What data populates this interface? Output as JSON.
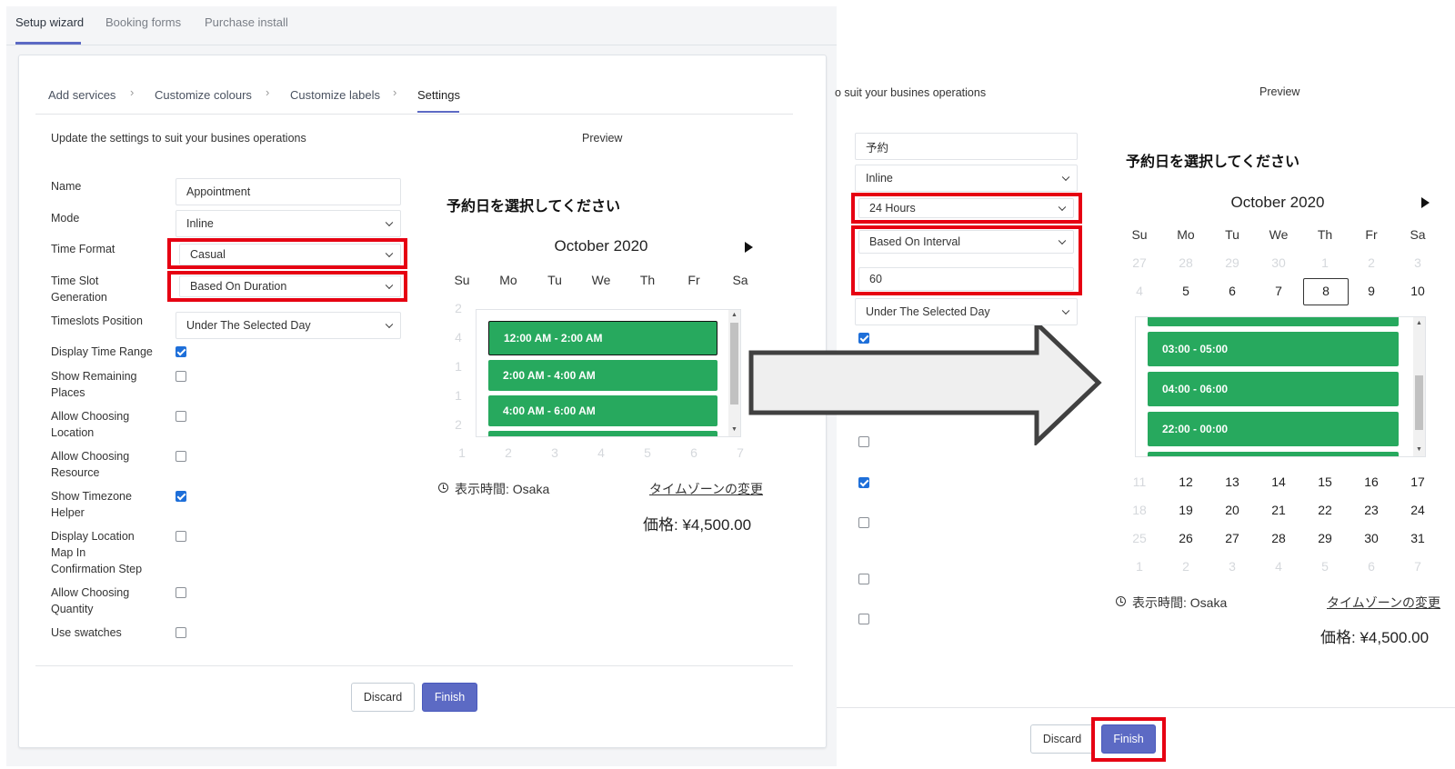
{
  "top_tabs": [
    "Setup wizard",
    "Booking forms",
    "Purchase install"
  ],
  "steps": [
    "Add services",
    "Customize colours",
    "Customize labels",
    "Settings"
  ],
  "left": {
    "subtitle": "Update the settings to suit your busines operations",
    "preview_title": "Preview",
    "fields": {
      "name_label": "Name",
      "name_value": "Appointment",
      "mode_label": "Mode",
      "mode_value": "Inline",
      "time_format_label": "Time Format",
      "time_format_value": "Casual",
      "slot_gen_label_1": "Time Slot",
      "slot_gen_label_2": "Generation",
      "slot_gen_value": "Based On Duration",
      "timeslots_pos_label": "Timeslots Position",
      "timeslots_pos_value": "Under The Selected Day"
    },
    "checkboxes": [
      {
        "label": [
          "Display Time Range"
        ],
        "checked": true
      },
      {
        "label": [
          "Show Remaining",
          "Places"
        ],
        "checked": false
      },
      {
        "label": [
          "Allow Choosing",
          "Location"
        ],
        "checked": false
      },
      {
        "label": [
          "Allow Choosing",
          "Resource"
        ],
        "checked": false
      },
      {
        "label": [
          "Show Timezone",
          "Helper"
        ],
        "checked": true
      },
      {
        "label": [
          "Display Location",
          "Map In",
          "Confirmation Step"
        ],
        "checked": false
      },
      {
        "label": [
          "Allow Choosing",
          "Quantity"
        ],
        "checked": false
      },
      {
        "label": [
          "Use swatches"
        ],
        "checked": false
      }
    ],
    "discard_label": "Discard",
    "finish_label": "Finish",
    "calendar": {
      "heading": "予約日を選択してください",
      "month": "October 2020",
      "weekdays": [
        "Su",
        "Mo",
        "Tu",
        "We",
        "Th",
        "Fr",
        "Sa"
      ],
      "left_col_days": [
        "2",
        "4",
        "1",
        "1",
        "2"
      ],
      "bottom_row": [
        "1",
        "2",
        "3",
        "4",
        "5",
        "6",
        "7"
      ],
      "slots": [
        "12:00 AM - 2:00 AM",
        "2:00 AM - 4:00 AM",
        "4:00 AM - 6:00 AM"
      ],
      "tz_text": "表示時間: Osaka",
      "tz_link": "タイムゾーンの変更",
      "price": "価格: ¥4,500.00"
    }
  },
  "right": {
    "subtitle": "o suit your busines operations",
    "preview_title": "Preview",
    "name_value": "予約",
    "mode_value": "Inline",
    "time_format_value": "24 Hours",
    "slot_gen_value": "Based On Interval",
    "interval_value": "60",
    "timeslots_pos_value": "Under The Selected Day",
    "checkbox_states": [
      true,
      false,
      true,
      false,
      false,
      false
    ],
    "discard_label": "Discard",
    "finish_label": "Finish",
    "calendar": {
      "heading": "予約日を選択してください",
      "month": "October 2020",
      "weekdays": [
        "Su",
        "Mo",
        "Tu",
        "We",
        "Th",
        "Fr",
        "Sa"
      ],
      "row1": [
        "27",
        "28",
        "29",
        "30",
        "1",
        "2",
        "3"
      ],
      "row2": [
        "4",
        "5",
        "6",
        "7",
        "8",
        "9",
        "10"
      ],
      "row3": [
        "11",
        "12",
        "13",
        "14",
        "15",
        "16",
        "17"
      ],
      "row4": [
        "18",
        "19",
        "20",
        "21",
        "22",
        "23",
        "24"
      ],
      "row5": [
        "25",
        "26",
        "27",
        "28",
        "29",
        "30",
        "31"
      ],
      "row6": [
        "1",
        "2",
        "3",
        "4",
        "5",
        "6",
        "7"
      ],
      "slots": [
        "03:00 - 05:00",
        "04:00 - 06:00",
        "22:00 - 00:00"
      ],
      "tz_text": "表示時間: Osaka",
      "tz_link": "タイムゾーンの変更",
      "price": "価格: ¥4,500.00"
    }
  },
  "colors": {
    "accent": "#5c6ac4",
    "highlight": "#e60012",
    "slot_green": "#27a95e",
    "checkbox_blue": "#1e6fd9"
  }
}
